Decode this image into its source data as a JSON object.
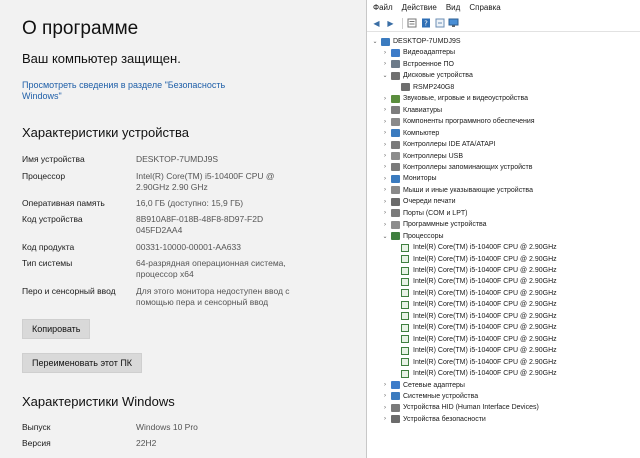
{
  "about": {
    "title": "О программе",
    "protected": "Ваш компьютер защищен.",
    "security_link": "Просмотреть сведения в разделе \"Безопасность Windows\"",
    "device_specs_heading": "Характеристики устройства",
    "device_specs": [
      {
        "key": "Имя устройства",
        "value": "DESKTOP-7UMDJ9S"
      },
      {
        "key": "Процессор",
        "value": "Intel(R) Core(TM) i5-10400F CPU @ 2.90GHz   2.90 GHz"
      },
      {
        "key": "Оперативная память",
        "value": "16,0 ГБ (доступно: 15,9 ГБ)"
      },
      {
        "key": "Код устройства",
        "value": "8B910A8F-018B-48F8-8D97-F2D045FD2AA4"
      },
      {
        "key": "Код продукта",
        "value": "00331-10000-00001-AA633"
      },
      {
        "key": "Тип системы",
        "value": "64-разрядная операционная система, процессор x64"
      },
      {
        "key": "Перо и сенсорный ввод",
        "value": "Для этого монитора недоступен ввод с помощью пера и сенсорный ввод"
      }
    ],
    "copy_button": "Копировать",
    "rename_button": "Переименовать этот ПК",
    "windows_specs_heading": "Характеристики Windows",
    "windows_specs": [
      {
        "key": "Выпуск",
        "value": "Windows 10 Pro"
      },
      {
        "key": "Версия",
        "value": "22H2"
      }
    ]
  },
  "device_manager": {
    "menu": [
      "Файл",
      "Действие",
      "Вид",
      "Справка"
    ],
    "toolbar_icons": [
      "back-icon",
      "forward-icon",
      "properties-icon",
      "help-icon",
      "update-icon",
      "monitor-icon"
    ],
    "root": "DESKTOP-7UMDJ9S",
    "categories": [
      {
        "label": "Видеоадаптеры",
        "expanded": false,
        "color": "#3d7cc9"
      },
      {
        "label": "Встроенное ПО",
        "expanded": false,
        "color": "#6c7a89"
      },
      {
        "label": "Дисковые устройства",
        "expanded": true,
        "color": "#707070",
        "children": [
          "RSMP240G8"
        ]
      },
      {
        "label": "Звуковые, игровые и видеоустройства",
        "expanded": false,
        "color": "#5b8e3e"
      },
      {
        "label": "Клавиатуры",
        "expanded": false,
        "color": "#7d7d7d"
      },
      {
        "label": "Компоненты программного обеспечения",
        "expanded": false,
        "color": "#8a8a8a"
      },
      {
        "label": "Компьютер",
        "expanded": false,
        "color": "#3b7bbf"
      },
      {
        "label": "Контроллеры IDE ATA/ATAPI",
        "expanded": false,
        "color": "#7a7a7a"
      },
      {
        "label": "Контроллеры USB",
        "expanded": false,
        "color": "#8c8c8c"
      },
      {
        "label": "Контроллеры запоминающих устройств",
        "expanded": false,
        "color": "#7b7b7b"
      },
      {
        "label": "Мониторы",
        "expanded": false,
        "color": "#3b7bbf"
      },
      {
        "label": "Мыши и иные указывающие устройства",
        "expanded": false,
        "color": "#8a8a8a"
      },
      {
        "label": "Очереди печати",
        "expanded": false,
        "color": "#6b6b6b"
      },
      {
        "label": "Порты (COM и LPT)",
        "expanded": false,
        "color": "#7a7a7a"
      },
      {
        "label": "Программные устройства",
        "expanded": false,
        "color": "#8c8c8c"
      },
      {
        "label": "Процессоры",
        "expanded": true,
        "color": "#3f7f3f",
        "children": [
          "Intel(R) Core(TM) i5-10400F CPU @ 2.90GHz",
          "Intel(R) Core(TM) i5-10400F CPU @ 2.90GHz",
          "Intel(R) Core(TM) i5-10400F CPU @ 2.90GHz",
          "Intel(R) Core(TM) i5-10400F CPU @ 2.90GHz",
          "Intel(R) Core(TM) i5-10400F CPU @ 2.90GHz",
          "Intel(R) Core(TM) i5-10400F CPU @ 2.90GHz",
          "Intel(R) Core(TM) i5-10400F CPU @ 2.90GHz",
          "Intel(R) Core(TM) i5-10400F CPU @ 2.90GHz",
          "Intel(R) Core(TM) i5-10400F CPU @ 2.90GHz",
          "Intel(R) Core(TM) i5-10400F CPU @ 2.90GHz",
          "Intel(R) Core(TM) i5-10400F CPU @ 2.90GHz",
          "Intel(R) Core(TM) i5-10400F CPU @ 2.90GHz"
        ]
      },
      {
        "label": "Сетевые адаптеры",
        "expanded": false,
        "color": "#3d7cc9"
      },
      {
        "label": "Системные устройства",
        "expanded": false,
        "color": "#3b7bbf"
      },
      {
        "label": "Устройства HID (Human Interface Devices)",
        "expanded": false,
        "color": "#7a7a7a"
      },
      {
        "label": "Устройства безопасности",
        "expanded": false,
        "color": "#6b6b6b"
      }
    ]
  }
}
